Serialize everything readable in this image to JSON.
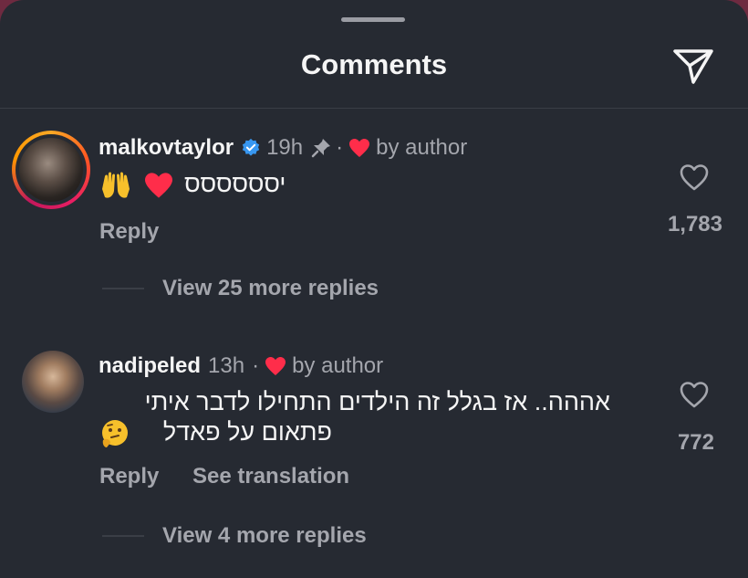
{
  "header": {
    "title": "Comments"
  },
  "comments": [
    {
      "username": "malkovtaylor",
      "verified": true,
      "time": "19h",
      "pinned": true,
      "dot": "·",
      "author_badge": "by author",
      "text": "יסססססס",
      "reply_label": "Reply",
      "likes": "1,783",
      "view_replies": "View 25 more replies"
    },
    {
      "username": "nadipeled",
      "time": "13h",
      "dot": "·",
      "author_badge": "by author",
      "text_line1": "אההה.. אז בגלל זה הילדים התחילו לדבר איתי",
      "text_line2": "פתאום על פאדל",
      "reply_label": "Reply",
      "translate_label": "See translation",
      "likes": "772",
      "view_replies": "View 4 more replies"
    }
  ],
  "colors": {
    "background": "#262a32",
    "muted_text": "#a4a6ad",
    "heart": "#ff2d4a",
    "verified": "#3897f0"
  }
}
